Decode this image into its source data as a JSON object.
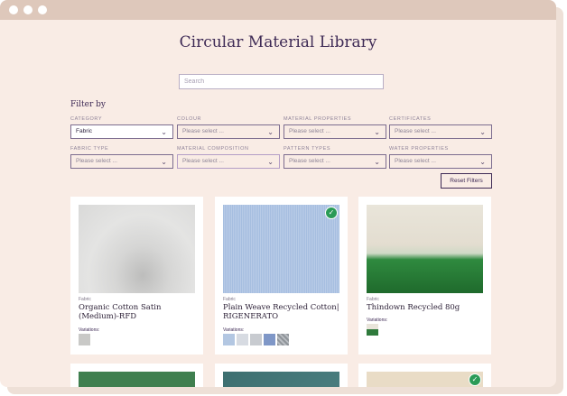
{
  "page": {
    "title": "Circular Material Library"
  },
  "search": {
    "placeholder": "Search"
  },
  "filters": {
    "heading": "Filter by",
    "reset_label": "Reset Filters",
    "items": [
      {
        "label": "CATEGORY",
        "value": "Fabric"
      },
      {
        "label": "COLOUR",
        "value": "Please select ..."
      },
      {
        "label": "MATERIAL PROPERTIES",
        "value": "Please select ..."
      },
      {
        "label": "CERTIFICATES",
        "value": "Please select ..."
      },
      {
        "label": "FABRIC TYPE",
        "value": "Please select ..."
      },
      {
        "label": "MATERIAL COMPOSITION",
        "value": "Please select ..."
      },
      {
        "label": "PATTERN TYPES",
        "value": "Please select ..."
      },
      {
        "label": "WATER PROPERTIES",
        "value": "Please select ..."
      }
    ]
  },
  "cards": [
    {
      "category": "Fabric",
      "name": "Organic Cotton Satin (Medium)-RFD",
      "variations_label": "Variations:",
      "image_color": "#dcdcdb",
      "swatches": [
        "#c9c9c7"
      ],
      "badge": false
    },
    {
      "category": "Fabric",
      "name": "Plain Weave Recycled Cotton| RIGENERATO",
      "variations_label": "Variations:",
      "image_color": "#a9c0e0",
      "swatches": [
        "#b3c7e2",
        "#d7dbe2",
        "#c8cbd0",
        "#7f97c7",
        "#a5a9ae"
      ],
      "badge": true
    },
    {
      "category": "Fabric",
      "name": "Thindown Recycled 80g",
      "variations_label": "Variations:",
      "image_color": "#2f7d3e",
      "swatches": [
        "#3a6b3f"
      ],
      "badge": false
    }
  ],
  "bottom_cards": [
    {
      "image_color": "#3f7f4f",
      "badge": false
    },
    {
      "image_color": "#3f6f6f",
      "badge": false
    },
    {
      "image_color": "#e9dcc6",
      "badge": true
    }
  ]
}
